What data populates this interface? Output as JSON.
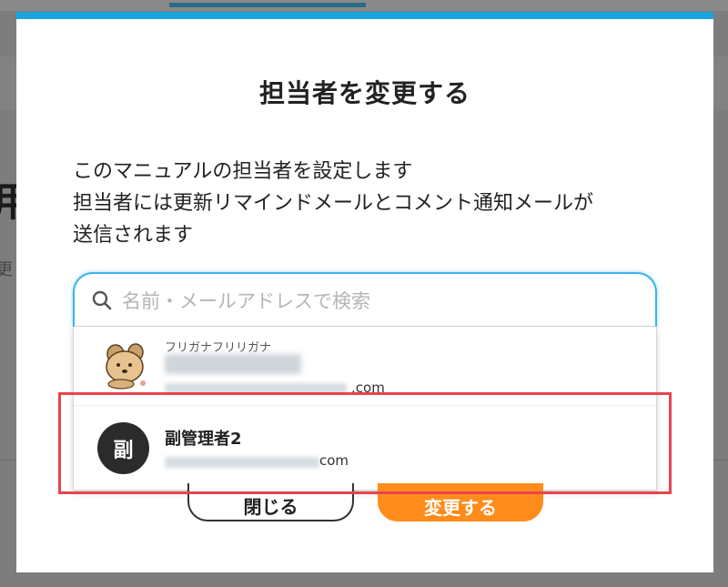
{
  "background": {
    "heading_char": "用",
    "sub_char": "更"
  },
  "modal": {
    "title": "担当者を変更する",
    "description_lines": [
      "このマニュアルの担当者を設定します",
      "担当者には更新リマインドメールとコメント通知メールが",
      "送信されます"
    ],
    "search": {
      "placeholder": "名前・メールアドレスで検索",
      "value": "",
      "icon": "search-icon"
    },
    "options": [
      {
        "kana": "フリガナフリリガナ",
        "email_suffix": ".com",
        "avatar": "dog-avatar"
      },
      {
        "avatar_initial": "副",
        "name": "副管理者2",
        "email_suffix": "com"
      }
    ],
    "buttons": {
      "close": "閉じる",
      "change": "変更する"
    }
  },
  "colors": {
    "accent": "#1aa3dc",
    "primary_button": "#ff8c1a",
    "highlight": "#e8434f"
  }
}
